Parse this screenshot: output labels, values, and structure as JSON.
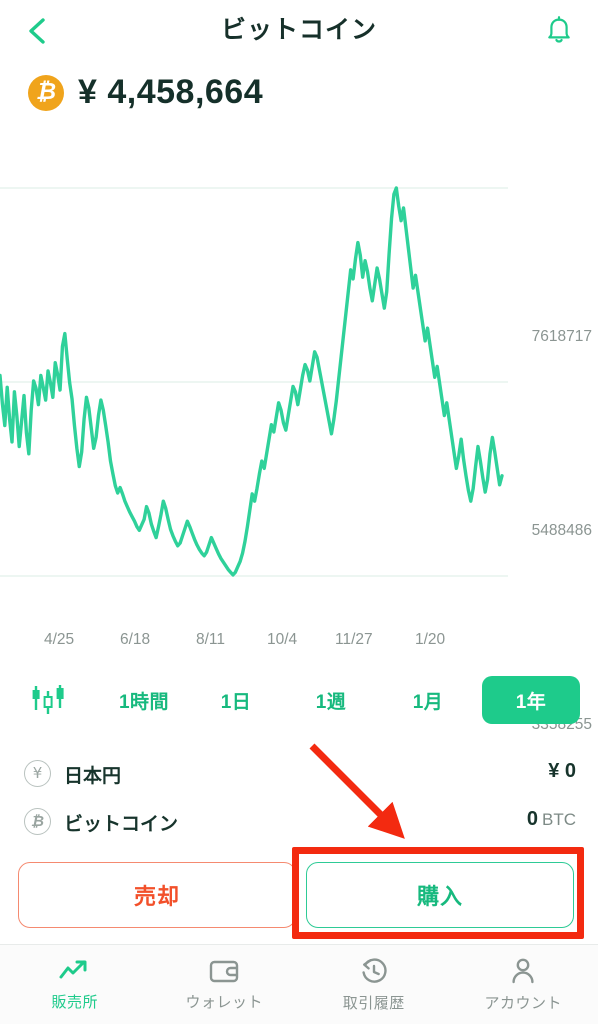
{
  "header": {
    "back_icon": "chevron-left-icon",
    "title": "ビットコイン",
    "bell_icon": "bell-icon"
  },
  "price": {
    "coin_icon": "bitcoin-icon",
    "coin_symbol": "₿",
    "amount": "¥ 4,458,664"
  },
  "chart_data": {
    "type": "line",
    "title": "ビットコイン",
    "xlabel": "",
    "ylabel": "",
    "grid": true,
    "legend": false,
    "line_color": "#2fd19a",
    "ylim": [
      3358255,
      7618717
    ],
    "ytick_labels": [
      "7618717",
      "5488486",
      "3358255"
    ],
    "ytick_values": [
      7618717,
      5488486,
      3358255
    ],
    "xtick_labels": [
      "4/25",
      "6/18",
      "8/11",
      "10/4",
      "11/27",
      "1/20"
    ],
    "x": [
      0,
      1,
      2,
      3,
      4,
      5,
      6,
      7,
      8,
      9,
      10,
      11,
      12,
      13,
      14,
      15,
      16,
      17,
      18,
      19,
      20,
      21,
      22,
      23,
      24,
      25,
      26,
      27,
      28,
      29,
      30,
      31,
      32,
      33,
      34,
      35,
      36,
      37,
      38,
      39,
      40,
      41,
      42,
      43,
      44,
      45,
      46,
      47,
      48,
      49,
      50,
      51,
      52,
      53,
      54,
      55,
      56,
      57,
      58,
      59,
      60,
      61,
      62,
      63,
      64,
      65,
      66,
      67,
      68,
      69,
      70,
      71,
      72,
      73,
      74,
      75,
      76,
      77,
      78,
      79,
      80,
      81,
      82,
      83,
      84,
      85,
      86,
      87,
      88,
      89,
      90,
      91,
      92,
      93,
      94,
      95,
      96,
      97,
      98,
      99,
      100,
      101,
      102,
      103,
      104,
      105,
      106,
      107,
      108,
      109,
      110,
      111,
      112,
      113,
      114,
      115,
      116,
      117,
      118,
      119,
      120,
      121,
      122,
      123,
      124,
      125,
      126,
      127,
      128,
      129,
      130,
      131,
      132,
      133,
      134,
      135,
      136,
      137,
      138,
      139,
      140,
      141,
      142,
      143,
      144,
      145,
      146,
      147,
      148,
      149,
      150,
      151,
      152,
      153,
      154,
      155,
      156,
      157,
      158,
      159,
      160,
      161,
      162,
      163,
      164,
      165,
      166,
      167,
      168,
      169,
      170,
      171,
      172,
      173,
      174,
      175,
      176,
      177,
      178,
      179,
      180,
      181,
      182,
      183,
      184,
      185,
      186,
      187,
      188,
      189,
      190,
      191,
      192,
      193,
      194,
      195,
      196,
      197,
      198,
      199
    ],
    "values": [
      5560000,
      5250000,
      5010000,
      5430000,
      5080000,
      4830000,
      5380000,
      5120000,
      4780000,
      5060000,
      5340000,
      4930000,
      4700000,
      5180000,
      5500000,
      5420000,
      5240000,
      5560000,
      5430000,
      5290000,
      5610000,
      5480000,
      5320000,
      5700000,
      5570000,
      5400000,
      5880000,
      6020000,
      5740000,
      5480000,
      5300000,
      5010000,
      4760000,
      4560000,
      4720000,
      5080000,
      5320000,
      5200000,
      4980000,
      4760000,
      4880000,
      5120000,
      5290000,
      5180000,
      5010000,
      4830000,
      4620000,
      4480000,
      4350000,
      4270000,
      4330000,
      4260000,
      4180000,
      4120000,
      4060000,
      4010000,
      3960000,
      3900000,
      3860000,
      3920000,
      3980000,
      4120000,
      4050000,
      3930000,
      3850000,
      3780000,
      3900000,
      4030000,
      4180000,
      4100000,
      3980000,
      3870000,
      3800000,
      3740000,
      3690000,
      3720000,
      3800000,
      3880000,
      3960000,
      3900000,
      3830000,
      3760000,
      3700000,
      3650000,
      3610000,
      3580000,
      3620000,
      3700000,
      3780000,
      3720000,
      3660000,
      3600000,
      3550000,
      3510000,
      3470000,
      3430000,
      3400000,
      3370000,
      3400000,
      3460000,
      3520000,
      3610000,
      3740000,
      3900000,
      4080000,
      4260000,
      4180000,
      4320000,
      4480000,
      4620000,
      4540000,
      4700000,
      4860000,
      5020000,
      4940000,
      5100000,
      5260000,
      5180000,
      5040000,
      4960000,
      5120000,
      5280000,
      5440000,
      5380000,
      5240000,
      5400000,
      5560000,
      5680000,
      5620000,
      5500000,
      5660000,
      5820000,
      5760000,
      5620000,
      5480000,
      5340000,
      5200000,
      5060000,
      4920000,
      5080000,
      5280000,
      5520000,
      5760000,
      6000000,
      6240000,
      6480000,
      6720000,
      6620000,
      6840000,
      7020000,
      6880000,
      6640000,
      6820000,
      6700000,
      6520000,
      6380000,
      6560000,
      6740000,
      6620000,
      6460000,
      6300000,
      6480000,
      6900000,
      7280000,
      7550000,
      7618717,
      7420000,
      7260000,
      7400000,
      7180000,
      6960000,
      6740000,
      6520000,
      6660000,
      6480000,
      6300000,
      6120000,
      5940000,
      6080000,
      5900000,
      5720000,
      5540000,
      5660000,
      5480000,
      5300000,
      5120000,
      5260000,
      5080000,
      4900000,
      4720000,
      4540000,
      4680000,
      4860000,
      4640000,
      4460000,
      4300000,
      4180000,
      4320000,
      4560000,
      4780000,
      4620000,
      4440000,
      4280000,
      4420000,
      4700000,
      4880000,
      4720000,
      4540000,
      4360000,
      4458664
    ]
  },
  "period_selector": {
    "candle_icon": "candlestick-icon",
    "options": [
      "1時間",
      "1日",
      "1週",
      "1月",
      "1年"
    ],
    "selected": "1年"
  },
  "balances": [
    {
      "icon": "yen-circle-icon",
      "symbol": "¥",
      "name": "日本円",
      "value": "¥ 0",
      "unit": ""
    },
    {
      "icon": "bitcoin-circle-icon",
      "symbol": "₿",
      "name": "ビットコイン",
      "value": "0",
      "unit": "BTC"
    }
  ],
  "actions": {
    "sell_label": "売却",
    "buy_label": "購入"
  },
  "annotation": {
    "color": "#f32a10",
    "arrow_icon": "pointer-arrow-icon",
    "highlight_target": "購入"
  },
  "bottom_nav": {
    "items": [
      {
        "icon": "trend-up-icon",
        "label": "販売所",
        "active": true
      },
      {
        "icon": "wallet-icon",
        "label": "ウォレット",
        "active": false
      },
      {
        "icon": "history-clock-icon",
        "label": "取引履歴",
        "active": false
      },
      {
        "icon": "person-icon",
        "label": "アカウント",
        "active": false
      }
    ]
  },
  "colors": {
    "brand_green": "#1ecb8b",
    "line_green": "#2fd19a",
    "sell_orange": "#f2502a",
    "bitcoin_orange": "#f0a41c",
    "annotation_red": "#f32a10",
    "muted_text": "#8b9592"
  }
}
